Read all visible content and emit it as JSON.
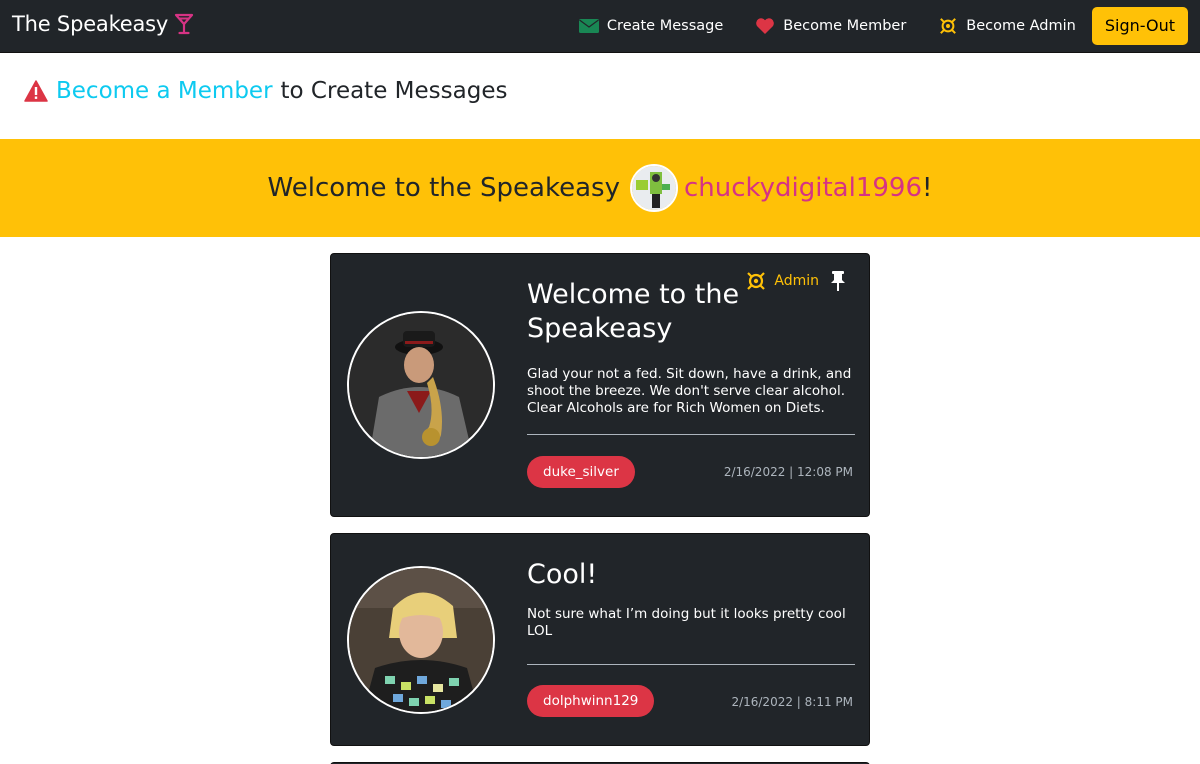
{
  "navbar": {
    "brand": "The Speakeasy",
    "brand_icon": "cocktail-icon",
    "items": [
      {
        "label": "Create Message",
        "icon": "envelope-icon",
        "color": "#198754"
      },
      {
        "label": "Become Member",
        "icon": "heart-icon",
        "color": "#dc3545"
      },
      {
        "label": "Become Admin",
        "icon": "admin-badge-icon",
        "color": "#ffc107"
      }
    ],
    "signout_label": "Sign-Out"
  },
  "notice": {
    "link_text": "Become a Member",
    "text": "to Create Messages"
  },
  "welcome": {
    "prefix": "Welcome to the Speakeasy",
    "username": "chuckydigital1996",
    "suffix": "!"
  },
  "messages": [
    {
      "title": "Welcome to the Speakeasy",
      "body": "Glad your not a fed. Sit down, have a drink, and shoot the breeze. We don't serve clear alcohol. Clear Alcohols are for Rich Women on Diets.",
      "author": "duke_silver",
      "timestamp": "2/16/2022 | 12:08 PM",
      "badge": "Admin",
      "pinned": true
    },
    {
      "title": "Cool!",
      "body": "Not sure what I’m doing but it looks pretty cool LOL",
      "author": "dolphwinn129",
      "timestamp": "2/16/2022 | 8:11 PM"
    }
  ],
  "colors": {
    "navbar": "#212529",
    "accent": "#ffc107",
    "link": "#0dcaf0",
    "username": "#d63384",
    "author_pill": "#dc3545"
  }
}
